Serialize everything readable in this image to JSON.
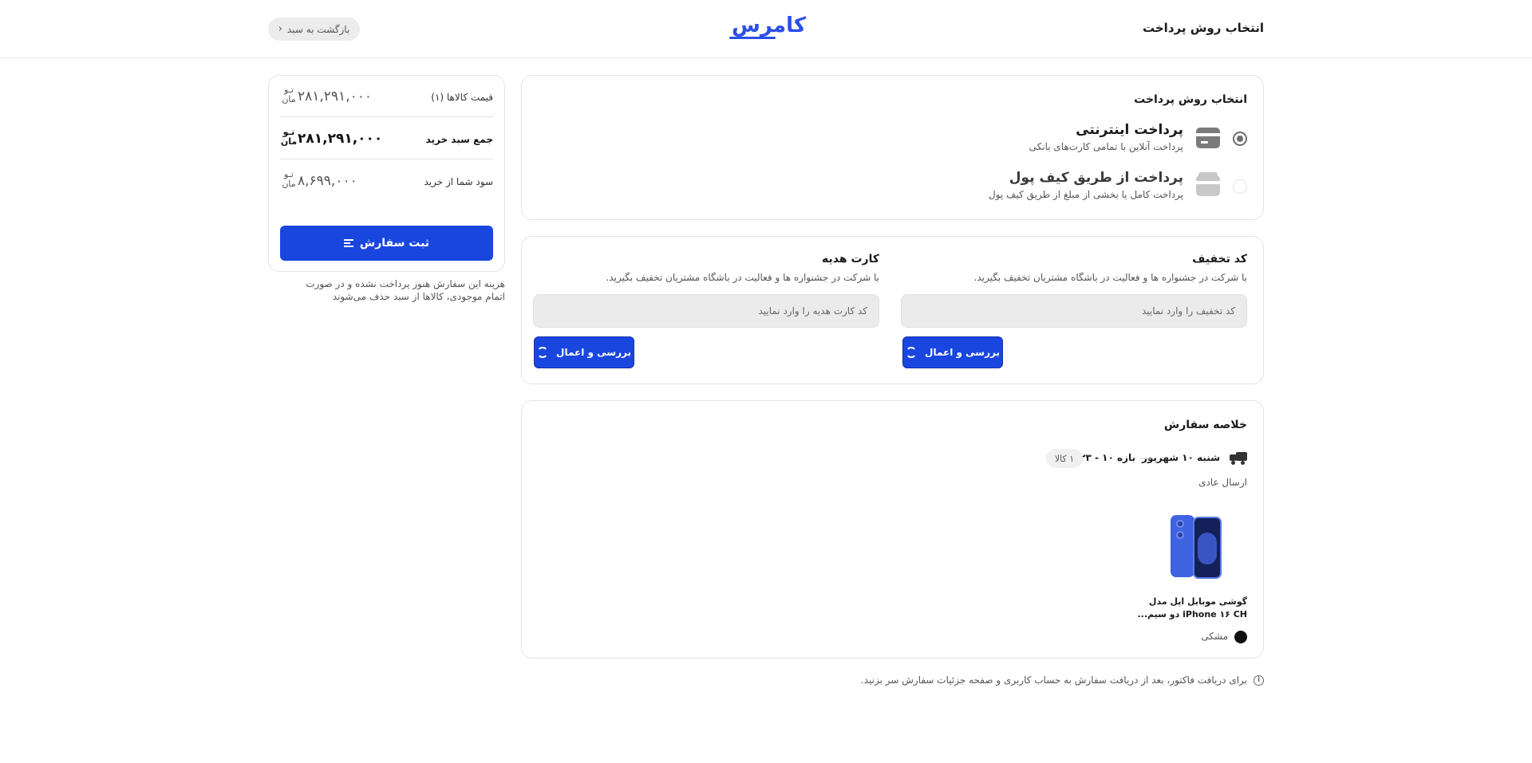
{
  "header": {
    "title": "انتخاب روش پرداخت",
    "logo_text": "کامرس",
    "back_label": "بازگشت به سبد"
  },
  "payment": {
    "title": "انتخاب روش پرداخت",
    "options": [
      {
        "name": "پرداخت اینترنتی",
        "desc": "پرداخت آنلاین با تمامی کارت‌های بانکی",
        "selected": true,
        "icon": "credit-card-icon"
      },
      {
        "name": "پرداخت از طریق کیف پول",
        "desc": "پرداخت کامل یا بخشی از مبلغ از طریق کیف پول",
        "selected": false,
        "icon": "wallet-icon"
      }
    ]
  },
  "discount": {
    "title": "کد تخفیف",
    "desc": "با شرکت در جشنواره ها و فعالیت در باشگاه مشتریان تخفیف بگیرید.",
    "placeholder": "کد تخفیف را وارد نمایید",
    "button": "بررسی و اعمال"
  },
  "gift": {
    "title": "کارت هدیه",
    "desc": "با شرکت در جشنواره ها و فعالیت در باشگاه مشتریان تخفیف بگیرید.",
    "placeholder": "کد کارت هدیه را وارد نمایید",
    "button": "بررسی و اعمال"
  },
  "order_summary": {
    "title": "خلاصه سفارش",
    "ship_date": "شنبه ۱۰ شهریور",
    "ship_range": "بازه ۱۰ - ۲۳",
    "item_count": "۱ کالا",
    "ship_type": "ارسال عادی",
    "product_name": "گوشی موبایل اپل مدل iPhone ۱۶ CH دو سیم...",
    "color_name": "مشکی",
    "color_hex": "#111111"
  },
  "info_text": "برای دریافت فاکتور، بعد از دریافت سفارش به حساب کاربری و صفحه جزئیات سفارش سر بزنید.",
  "price_summary": {
    "rows": [
      {
        "label": "قیمت کالاها (۱)",
        "value": "۲۸۱,۲۹۱,۰۰۰",
        "currency": "تـو مان"
      },
      {
        "label": "جمع سبد خرید",
        "value": "۲۸۱,۲۹۱,۰۰۰",
        "currency": "تـو مان"
      },
      {
        "label": "سود شما از خرید",
        "value": "۸,۶۹۹,۰۰۰",
        "currency": "تـو مان"
      }
    ],
    "order_button": "ثبت سفارش",
    "note": "هزینه این سفارش هنوز پرداخت نشده و در صورت اتمام موجودی، کالاها از سبد حذف می‌شوند"
  },
  "colors": {
    "primary": "#1a46e0",
    "logo": "#2b4ee6"
  }
}
